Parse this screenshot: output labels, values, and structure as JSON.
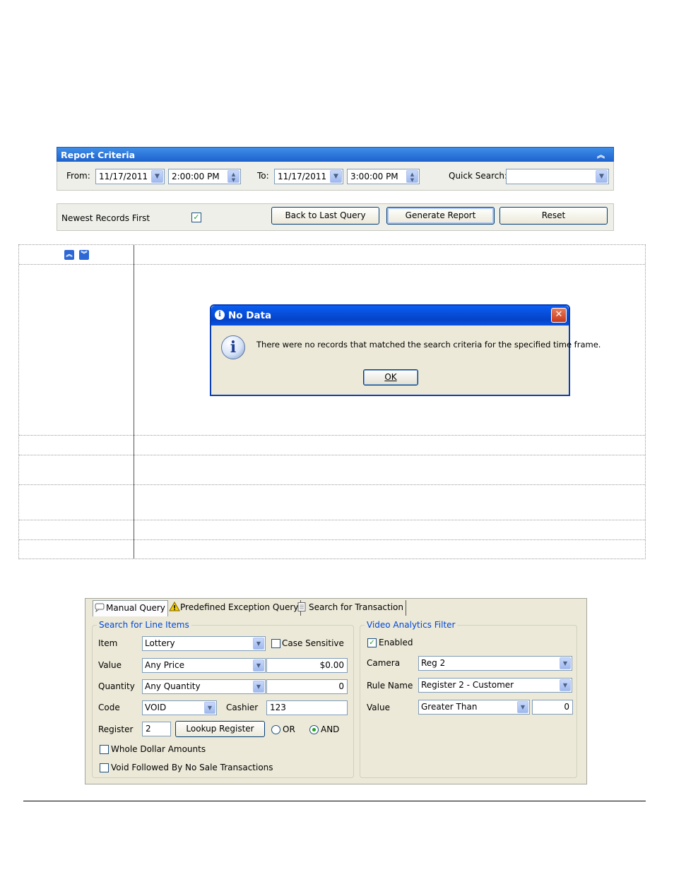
{
  "report_criteria": {
    "title": "Report Criteria",
    "collapse_glyph": "«",
    "from_label": "From:",
    "from_date": "11/17/2011",
    "from_time": "2:00:00 PM",
    "to_label": "To:",
    "to_date": "11/17/2011",
    "to_time": "3:00:00 PM",
    "quick_search_label": "Quick Search:",
    "quick_search_value": "",
    "newest_first_label": "Newest Records First",
    "newest_first_checked": true,
    "back_button": "Back to Last Query",
    "generate_button": "Generate Report",
    "reset_button": "Reset"
  },
  "icons": {
    "dropdown": "chevron-down-icon",
    "spinner": "spin-updown-icon",
    "collapse_up": "double-chevron-up-icon",
    "expand_down": "double-chevron-down-icon",
    "info": "info-icon",
    "close": "close-icon"
  },
  "dialog": {
    "title": "No Data",
    "message": "There were no records that matched the search criteria for the specified time frame.",
    "ok": "OK"
  },
  "query_panel": {
    "tabs": [
      {
        "label": "Manual Query",
        "active": true
      },
      {
        "label": "Predefined Exception Query",
        "active": false
      },
      {
        "label": "Search for Transaction",
        "active": false
      }
    ],
    "line_items": {
      "legend": "Search for Line Items",
      "item_label": "Item",
      "item_value": "Lottery",
      "case_sensitive_label": "Case Sensitive",
      "value_label": "Value",
      "value_select": "Any Price",
      "value_amount": "$0.00",
      "quantity_label": "Quantity",
      "quantity_select": "Any Quantity",
      "quantity_amount": "0",
      "code_label": "Code",
      "code_value": "VOID",
      "cashier_label": "Cashier",
      "cashier_value": "123",
      "register_label": "Register",
      "register_value": "2",
      "lookup_button": "Lookup Register",
      "or_label": "OR",
      "and_label": "AND",
      "whole_dollar_label": "Whole Dollar Amounts",
      "void_no_sale_label": "Void Followed By No Sale Transactions"
    },
    "video_filter": {
      "legend": "Video Analytics Filter",
      "enabled_label": "Enabled",
      "camera_label": "Camera",
      "camera_value": "Reg 2",
      "rule_label": "Rule Name",
      "rule_value": "Register 2 - Customer",
      "value_label": "Value",
      "value_select": "Greater Than",
      "value_amount": "0"
    }
  },
  "colors": {
    "xp_blue_header": "#1f64cf",
    "legend_blue": "#0046d5",
    "panel_bg": "#ece9d8"
  }
}
